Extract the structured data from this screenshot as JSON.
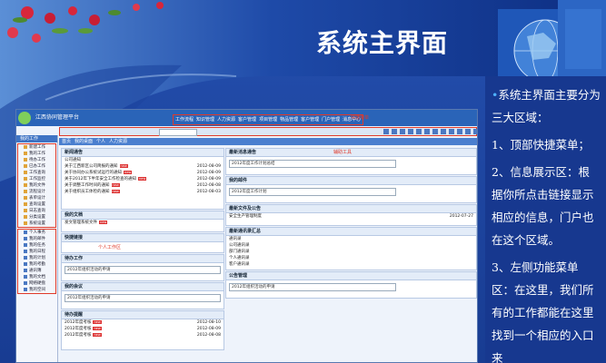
{
  "slide": {
    "title": "系统主界面",
    "description": [
      {
        "bullet": "",
        "text": "系统主界面主要分为三大区域："
      },
      {
        "bullet": "",
        "text": "1、顶部快捷菜单；"
      },
      {
        "bullet": "",
        "text": "2、信息展示区：根据你所点击链接显示相应的信息，门户也在这个区域。"
      },
      {
        "bullet": "",
        "text": "3、左侧功能菜单区：在这里，我们所有的工作都能在这里找到一个相应的入口来"
      }
    ]
  },
  "app": {
    "name": "江西协同管理平台",
    "top_menu": [
      "工作流程",
      "知识管理",
      "人力资源",
      "客户管理",
      "项目管理",
      "物品管理",
      "客户管理",
      "门户管理",
      "消息中心"
    ],
    "annotation_top": "快捷菜单",
    "annotation_toolbar": "辅助工具",
    "annotation_personal": "个人工作区",
    "tabs": [
      "首页",
      "我的桌面",
      "个人",
      "人力资源"
    ],
    "sidebar": {
      "header": "我的工作",
      "group1": [
        "新建工作",
        "我的工作",
        "待办工作",
        "已办工作",
        "工作查询",
        "工作监控",
        "我的文件",
        "流程设计",
        "表单设计",
        "查询设置",
        "日志查询",
        "分类设置",
        "系统设置"
      ],
      "group2": [
        "个人事务",
        "我的邮件",
        "我的任务",
        "我的日程",
        "我的计划",
        "我的考勤",
        "通讯簿",
        "我的文档",
        "网络硬盘",
        "我的空间"
      ]
    },
    "panels": {
      "news": {
        "title": "新闻通告",
        "tag": "公司通知",
        "rows": [
          {
            "text": "关于江西新区公司简报的通知",
            "date": "2012-08-09"
          },
          {
            "text": "关于协同办公系统试运行的通知",
            "date": "2012-08-09"
          },
          {
            "text": "关于2012年下半年安全工作检查的通知",
            "date": "2012-08-09"
          },
          {
            "text": "关于调整工作时间的通知",
            "date": "2012-08-08"
          },
          {
            "text": "关于组织员工体检的通知",
            "date": "2012-08-03"
          }
        ]
      },
      "docs": {
        "title": "我的文档",
        "rows": [
          {
            "text": "发文管理系统文件",
            "date": "2012-07-27"
          }
        ]
      },
      "links": {
        "title": "快捷链接",
        "rows": [
          {
            "text": "常用链接",
            "date": ""
          }
        ]
      },
      "todo": {
        "title": "待办工作",
        "fields": [
          "2012年组织活动的申请"
        ]
      },
      "meeting": {
        "title": "我的会议",
        "fields": [
          "2012年组织活动的申请"
        ]
      },
      "plan": {
        "title": "待办提醒",
        "rows": [
          {
            "text": "2012年度考核",
            "date": "2012-08-10"
          },
          {
            "text": "2012年度考核",
            "date": "2012-08-09"
          },
          {
            "text": "2012年度考核",
            "date": "2012-08-08"
          }
        ]
      },
      "right1": {
        "title": "最新消息通告",
        "fields": [
          "2012年度工作计划总结"
        ]
      },
      "right2": {
        "title": "我的邮件",
        "fields": [
          "2012年度工作计划"
        ]
      },
      "right3": {
        "title": "最新文件及公告",
        "rows": [
          {
            "text": "安全生产管理制度",
            "date": "2012-07-27"
          }
        ]
      },
      "right4": {
        "title": "最新通讯录汇总",
        "rows": [
          {
            "text": "通讯录",
            "date": ""
          },
          {
            "text": "公司通讯录",
            "date": ""
          },
          {
            "text": "部门通讯录",
            "date": ""
          },
          {
            "text": "个人通讯录",
            "date": ""
          },
          {
            "text": "客户通讯录",
            "date": ""
          }
        ]
      },
      "right5": {
        "title": "公告管理",
        "fields": [
          "2012年组织活动的申请"
        ]
      }
    }
  }
}
